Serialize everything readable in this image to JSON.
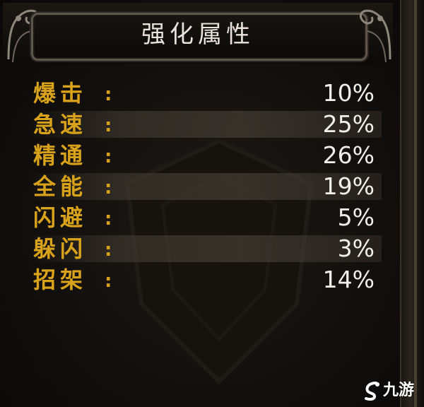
{
  "header": {
    "title": "强化属性"
  },
  "stats": [
    {
      "label": "爆击",
      "colon": ":",
      "value": "10%"
    },
    {
      "label": "急速",
      "colon": ":",
      "value": "25%"
    },
    {
      "label": "精通",
      "colon": ":",
      "value": "26%"
    },
    {
      "label": "全能",
      "colon": ":",
      "value": "19%"
    },
    {
      "label": "闪避",
      "colon": ":",
      "value": "5%"
    },
    {
      "label": "躲闪",
      "colon": ":",
      "value": "3%"
    },
    {
      "label": "招架",
      "colon": ":",
      "value": "14%"
    }
  ],
  "watermark": {
    "text": "九游",
    "icon": "jiuyou-logo-icon"
  },
  "colors": {
    "label": "#d9a21b",
    "value": "#f2f0ea",
    "title": "#e8e4dc",
    "background": "#0f0d0b"
  }
}
